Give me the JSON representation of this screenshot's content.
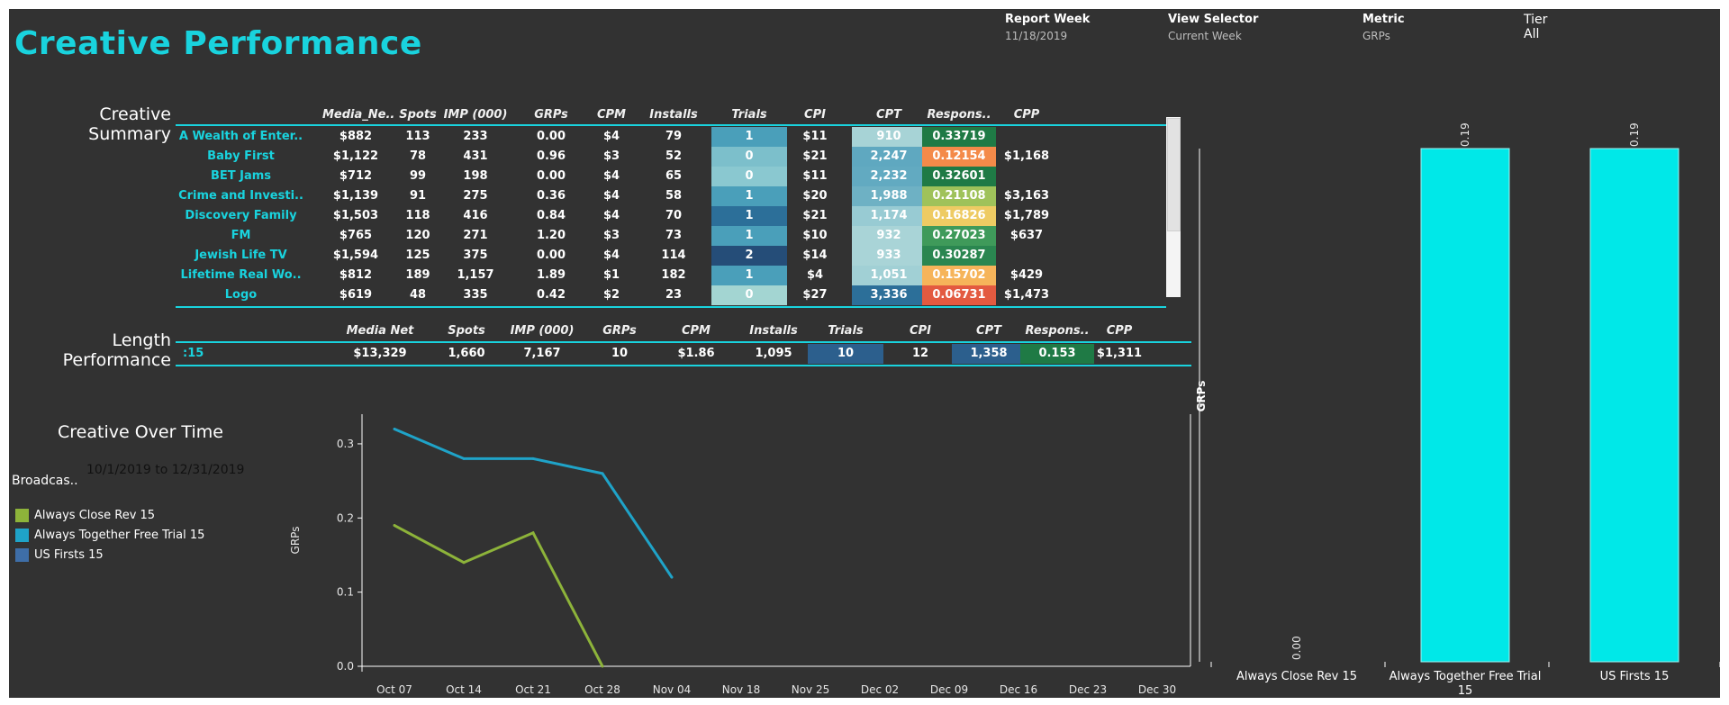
{
  "header": {
    "title": "Creative Performance",
    "filters": [
      {
        "label": "Report Week",
        "value": "11/18/2019"
      },
      {
        "label": "View Selector",
        "value": "Current Week"
      },
      {
        "label": "Metric",
        "value": "GRPs"
      }
    ],
    "tier": {
      "label": "Tier",
      "value": "All"
    }
  },
  "creative_summary": {
    "title_line1": "Creative",
    "title_line2": "Summary",
    "columns": [
      "Media_Ne..",
      "Spots",
      "IMP (000)",
      "GRPs",
      "CPM",
      "Installs",
      "Trials",
      "CPI",
      "CPT",
      "Respons..",
      "CPP"
    ],
    "rows": [
      {
        "label": "A Wealth of Enter..",
        "cells": [
          "$882",
          "113",
          "233",
          "0.00",
          "$4",
          "79",
          "1",
          "$11",
          "910",
          "0.33719",
          ""
        ],
        "trial_color": "#4a9fba",
        "cpt_color": "#a7d3d6",
        "resp_color": "#1f7a45"
      },
      {
        "label": "Baby First",
        "cells": [
          "$1,122",
          "78",
          "431",
          "0.96",
          "$3",
          "52",
          "0",
          "$21",
          "2,247",
          "0.12154",
          "$1,168"
        ],
        "trial_color": "#7cbfcb",
        "cpt_color": "#5fa8c0",
        "resp_color": "#f48a49"
      },
      {
        "label": "BET Jams",
        "cells": [
          "$712",
          "99",
          "198",
          "0.00",
          "$4",
          "65",
          "0",
          "$11",
          "2,232",
          "0.32601",
          ""
        ],
        "trial_color": "#8ac8d0",
        "cpt_color": "#62aac1",
        "resp_color": "#1f7a45"
      },
      {
        "label": "Crime and Investi..",
        "cells": [
          "$1,139",
          "91",
          "275",
          "0.36",
          "$4",
          "58",
          "1",
          "$20",
          "1,988",
          "0.21108",
          "$3,163"
        ],
        "trial_color": "#4a9fba",
        "cpt_color": "#6eb1c4",
        "resp_color": "#9fc25a"
      },
      {
        "label": "Discovery Family",
        "cells": [
          "$1,503",
          "118",
          "416",
          "0.84",
          "$4",
          "70",
          "1",
          "$21",
          "1,174",
          "0.16826",
          "$1,789"
        ],
        "trial_color": "#2c6f99",
        "cpt_color": "#98cbd3",
        "resp_color": "#eecb63"
      },
      {
        "label": "FM",
        "cells": [
          "$765",
          "120",
          "271",
          "1.20",
          "$3",
          "73",
          "1",
          "$10",
          "932",
          "0.27023",
          "$637"
        ],
        "trial_color": "#4a9fba",
        "cpt_color": "#a9d4d7",
        "resp_color": "#3f9a5a"
      },
      {
        "label": "Jewish Life TV",
        "cells": [
          "$1,594",
          "125",
          "375",
          "0.00",
          "$4",
          "114",
          "2",
          "$14",
          "933",
          "0.30287",
          ""
        ],
        "trial_color": "#254d78",
        "cpt_color": "#a9d4d7",
        "resp_color": "#2a8650"
      },
      {
        "label": "Lifetime Real Wo..",
        "cells": [
          "$812",
          "189",
          "1,157",
          "1.89",
          "$1",
          "182",
          "1",
          "$4",
          "1,051",
          "0.15702",
          "$429"
        ],
        "trial_color": "#4a9fba",
        "cpt_color": "#a1d0d5",
        "resp_color": "#f6b45a"
      },
      {
        "label": "Logo",
        "cells": [
          "$619",
          "48",
          "335",
          "0.42",
          "$2",
          "23",
          "0",
          "$27",
          "3,336",
          "0.06731",
          "$1,473"
        ],
        "trial_color": "#a3d5d2",
        "cpt_color": "#2c6f99",
        "resp_color": "#e35a40"
      }
    ]
  },
  "length_performance": {
    "title_line1": "Length",
    "title_line2": "Performance",
    "columns": [
      "Media Net",
      "Spots",
      "IMP (000)",
      "GRPs",
      "CPM",
      "Installs",
      "Trials",
      "CPI",
      "CPT",
      "Respons..",
      "CPP"
    ],
    "row": {
      "label": ":15",
      "cells": [
        "$13,329",
        "1,660",
        "7,167",
        "10",
        "$1.86",
        "1,095",
        "10",
        "12",
        "1,358",
        "0.153",
        "$1,311"
      ]
    },
    "trial_color": "#2c5f8d",
    "cpt_color": "#2c5f8d",
    "resp_color": "#1f7a45"
  },
  "creative_over_time": {
    "title": "Creative Over Time",
    "date_range": "10/1/2019 to 12/31/2019",
    "broadcast_label": "Broadcas..",
    "legend": [
      {
        "name": "Always Close Rev 15",
        "color": "#8db33a"
      },
      {
        "name": "Always Together Free Trial 15",
        "color": "#1fa3c8"
      },
      {
        "name": "US Firsts 15",
        "color": "#3e6ea8"
      }
    ]
  },
  "chart_data": [
    {
      "type": "line",
      "title": "",
      "xlabel": "",
      "ylabel": "GRPs",
      "x": [
        "Oct 07",
        "Oct 14",
        "Oct 21",
        "Oct 28",
        "Nov 04",
        "Nov 18",
        "Nov 25",
        "Dec 02",
        "Dec 09",
        "Dec 16",
        "Dec 23",
        "Dec 30"
      ],
      "ylim": [
        0,
        0.34
      ],
      "yticks": [
        "0.0",
        "0.1",
        "0.2",
        "0.3"
      ],
      "grid": false,
      "series": [
        {
          "name": "Always Close Rev 15",
          "color": "#8db33a",
          "values": [
            0.19,
            0.14,
            0.18,
            0.0,
            null,
            null,
            null,
            null,
            null,
            null,
            null,
            null
          ]
        },
        {
          "name": "Always Together Free Trial 15",
          "color": "#1fa3c8",
          "values": [
            0.32,
            0.28,
            0.28,
            0.26,
            0.12,
            null,
            null,
            null,
            null,
            null,
            null,
            null
          ]
        }
      ]
    },
    {
      "type": "bar",
      "ylabel": "GRPs",
      "categories": [
        "Always Close Rev 15",
        "Always Together Free Trial 15",
        "US Firsts 15"
      ],
      "values": [
        0.0,
        0.19,
        0.19
      ],
      "data_labels": [
        "0.00",
        "0.19",
        "0.19"
      ],
      "ylim": [
        0,
        0.19
      ],
      "bar_color": "#00e8e8"
    }
  ]
}
